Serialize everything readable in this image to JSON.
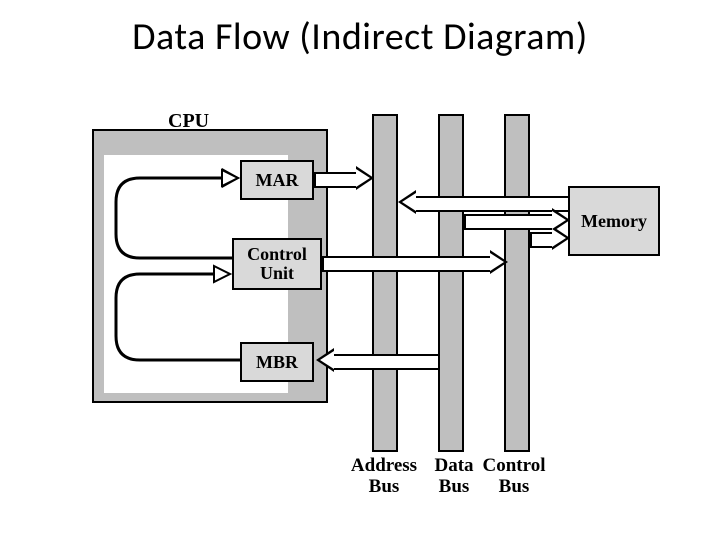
{
  "title": "Data Flow (Indirect Diagram)",
  "cpu": {
    "label": "CPU",
    "components": {
      "mar": "MAR",
      "control_unit": "Control\nUnit",
      "mbr": "MBR"
    }
  },
  "memory": {
    "label": "Memory"
  },
  "buses": {
    "address": "Address\nBus",
    "data": "Data\nBus",
    "control": "Control\nBus"
  },
  "arrows": [
    {
      "name": "mar-to-address-bus",
      "dir": "right",
      "from": "MAR",
      "to": "Address Bus"
    },
    {
      "name": "control-to-control-bus",
      "dir": "right",
      "from": "Control Unit",
      "to": "Control Bus"
    },
    {
      "name": "data-bus-to-mbr",
      "dir": "left",
      "from": "Data Bus",
      "to": "MBR"
    },
    {
      "name": "memory-to-address-bus",
      "dir": "left",
      "from": "Memory",
      "to": "Address Bus"
    },
    {
      "name": "data-bus-to-memory",
      "dir": "right",
      "from": "Data Bus",
      "to": "Memory"
    },
    {
      "name": "control-bus-to-memory",
      "dir": "right",
      "from": "Control Bus",
      "to": "Memory"
    }
  ],
  "internal_links": [
    {
      "name": "control-unit-to-mar",
      "from": "Control Unit",
      "to": "MAR"
    },
    {
      "name": "mbr-to-control-unit",
      "from": "MBR",
      "to": "Control Unit"
    }
  ]
}
